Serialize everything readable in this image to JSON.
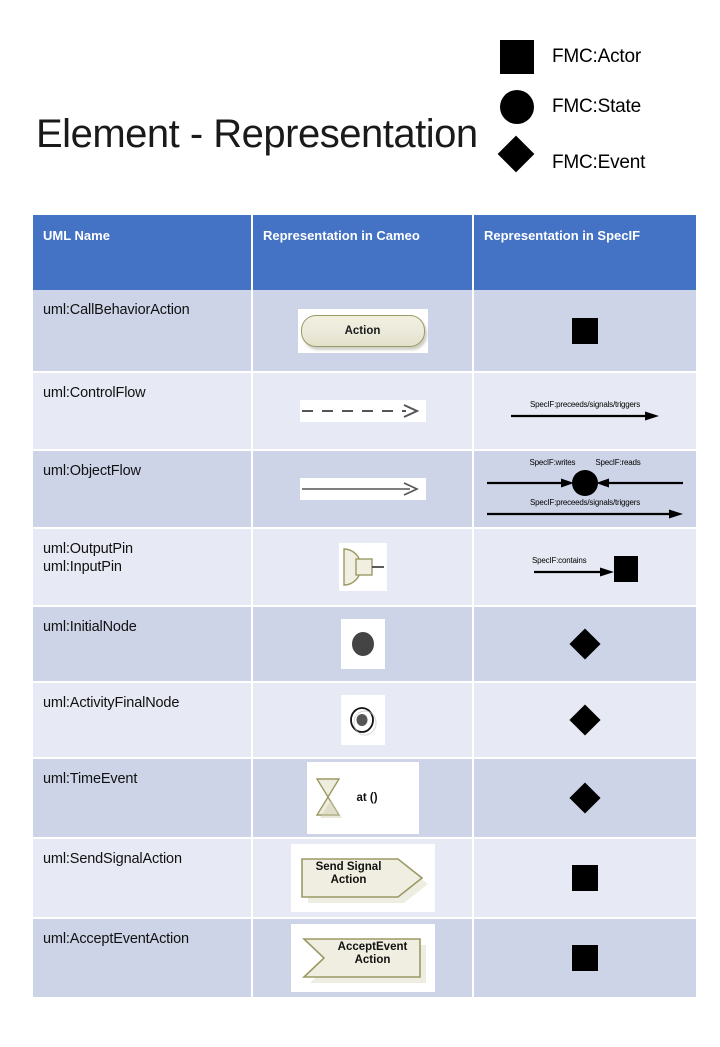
{
  "title": "Element - Representation",
  "legend": [
    {
      "shape": "square-icon",
      "label": "FMC:Actor"
    },
    {
      "shape": "circle-icon",
      "label": "FMC:State"
    },
    {
      "shape": "diamond-icon",
      "label": "FMC:Event"
    }
  ],
  "colors": {
    "header_blue": "#4472C4",
    "row_shade_dark": "#CDD4E8",
    "row_shade_light": "#E7EAF4",
    "glyph_black": "#000000",
    "cameo_fill": "#ECEADB",
    "cameo_stroke": "#9A9A66"
  },
  "table": {
    "columns": [
      "UML Name",
      "Representation in Cameo",
      "Representation in SpecIF"
    ],
    "rows": [
      {
        "name": "uml:CallBehaviorAction",
        "name2": "",
        "cameo_text": "Action",
        "specif_labels": []
      },
      {
        "name": "uml:ControlFlow",
        "name2": "",
        "cameo_text": "",
        "specif_labels": [
          "SpecIF:preceeds/signals/triggers"
        ]
      },
      {
        "name": "uml:ObjectFlow",
        "name2": "",
        "cameo_text": "",
        "specif_labels": [
          "SpecIF:writes",
          "SpecIF:reads",
          "SpecIF:preceeds/signals/triggers"
        ]
      },
      {
        "name": "uml:OutputPin",
        "name2": "uml:InputPin",
        "cameo_text": "",
        "specif_labels": [
          "SpecIF:contains"
        ]
      },
      {
        "name": "uml:InitialNode",
        "name2": "",
        "cameo_text": "",
        "specif_labels": []
      },
      {
        "name": "uml:ActivityFinalNode",
        "name2": "",
        "cameo_text": "",
        "specif_labels": []
      },
      {
        "name": "uml:TimeEvent",
        "name2": "",
        "cameo_text": "at ()",
        "specif_labels": []
      },
      {
        "name": "uml:SendSignalAction",
        "name2": "",
        "cameo_text": "Send Signal\nAction",
        "specif_labels": []
      },
      {
        "name": "uml:AcceptEventAction",
        "name2": "",
        "cameo_text": "AcceptEvent\nAction",
        "specif_labels": []
      }
    ]
  }
}
